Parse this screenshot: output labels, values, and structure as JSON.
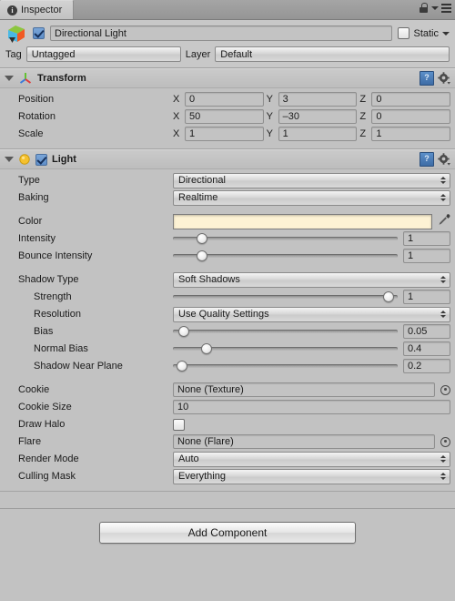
{
  "window": {
    "tab_label": "Inspector",
    "tab_icon": "info-icon",
    "lock_icon": "lock-icon",
    "menu_icon": "hamburger-menu-icon"
  },
  "object_header": {
    "prefab_icon": "gameobject-cube-icon",
    "enabled": true,
    "name": "Directional Light",
    "static_label": "Static",
    "static_checked": false,
    "tag_label": "Tag",
    "tag_value": "Untagged",
    "layer_label": "Layer",
    "layer_value": "Default"
  },
  "transform": {
    "title": "Transform",
    "icon": "transform-gizmo-icon",
    "help_icon": "help-book-icon",
    "gear_icon": "gear-icon",
    "axes": [
      "X",
      "Y",
      "Z"
    ],
    "rows": [
      {
        "label": "Position",
        "values": [
          "0",
          "3",
          "0"
        ]
      },
      {
        "label": "Rotation",
        "values": [
          "50",
          "–30",
          "0"
        ]
      },
      {
        "label": "Scale",
        "values": [
          "1",
          "1",
          "1"
        ]
      }
    ]
  },
  "light": {
    "title": "Light",
    "icon": "light-bulb-icon",
    "enabled": true,
    "help_icon": "help-book-icon",
    "gear_icon": "gear-icon",
    "type": {
      "label": "Type",
      "value": "Directional"
    },
    "baking": {
      "label": "Baking",
      "value": "Realtime"
    },
    "color": {
      "label": "Color",
      "value": "#fdf2d4",
      "eyedropper_icon": "eyedropper-icon"
    },
    "intensity": {
      "label": "Intensity",
      "value": "1",
      "slider_pct": 13
    },
    "bounce_intensity": {
      "label": "Bounce Intensity",
      "value": "1",
      "slider_pct": 13
    },
    "shadow_type": {
      "label": "Shadow Type",
      "value": "Soft Shadows"
    },
    "strength": {
      "label": "Strength",
      "value": "1",
      "slider_pct": 96
    },
    "resolution": {
      "label": "Resolution",
      "value": "Use Quality Settings"
    },
    "bias": {
      "label": "Bias",
      "value": "0.05",
      "slider_pct": 5
    },
    "normal_bias": {
      "label": "Normal Bias",
      "value": "0.4",
      "slider_pct": 15
    },
    "shadow_near_plane": {
      "label": "Shadow Near Plane",
      "value": "0.2",
      "slider_pct": 4
    },
    "cookie": {
      "label": "Cookie",
      "value": "None (Texture)",
      "picker_icon": "object-picker-icon"
    },
    "cookie_size": {
      "label": "Cookie Size",
      "value": "10"
    },
    "draw_halo": {
      "label": "Draw Halo",
      "checked": false
    },
    "flare": {
      "label": "Flare",
      "value": "None (Flare)",
      "picker_icon": "object-picker-icon"
    },
    "render_mode": {
      "label": "Render Mode",
      "value": "Auto"
    },
    "culling_mask": {
      "label": "Culling Mask",
      "value": "Everything"
    }
  },
  "footer": {
    "add_component_label": "Add Component"
  }
}
